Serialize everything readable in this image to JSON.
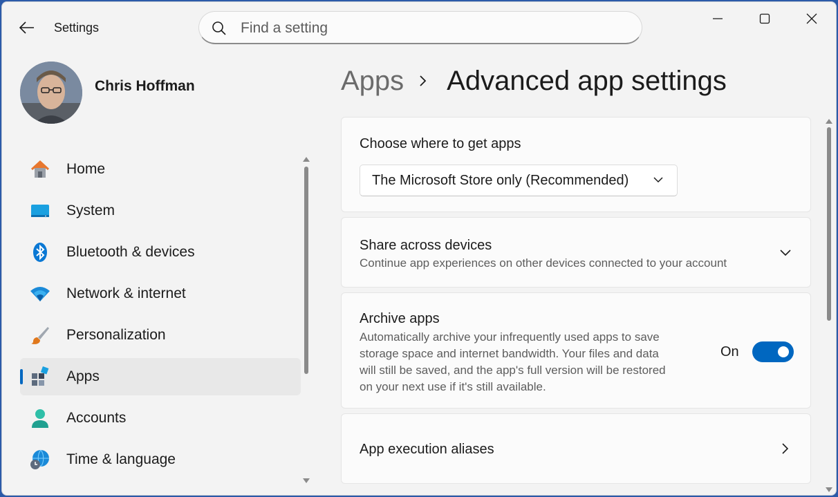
{
  "window": {
    "title": "Settings"
  },
  "search": {
    "placeholder": "Find a setting"
  },
  "profile": {
    "name": "Chris Hoffman"
  },
  "nav": {
    "items": [
      {
        "label": "Home",
        "icon": "home-icon"
      },
      {
        "label": "System",
        "icon": "system-icon"
      },
      {
        "label": "Bluetooth & devices",
        "icon": "bluetooth-icon"
      },
      {
        "label": "Network & internet",
        "icon": "wifi-icon"
      },
      {
        "label": "Personalization",
        "icon": "brush-icon"
      },
      {
        "label": "Apps",
        "icon": "apps-icon",
        "selected": true
      },
      {
        "label": "Accounts",
        "icon": "accounts-icon"
      },
      {
        "label": "Time & language",
        "icon": "globe-clock-icon"
      }
    ]
  },
  "breadcrumb": {
    "parent": "Apps",
    "current": "Advanced app settings"
  },
  "cards": {
    "where_apps": {
      "heading": "Choose where to get apps",
      "dropdown_value": "The Microsoft Store only (Recommended)"
    },
    "share": {
      "heading": "Share across devices",
      "description": "Continue app experiences on other devices connected to your account"
    },
    "archive": {
      "heading": "Archive apps",
      "description_lines": [
        "Automatically archive your infrequently used apps to save",
        "storage space and internet bandwidth. Your files and data",
        "will still be saved, and the app's full version will be restored",
        "on your next use if it's still available."
      ],
      "toggle_label": "On",
      "toggle_on": true
    },
    "aliases": {
      "heading": "App execution aliases"
    }
  },
  "colors": {
    "accent": "#0067c0",
    "window_bg": "#f3f3f3",
    "card_bg": "#fbfbfb"
  }
}
